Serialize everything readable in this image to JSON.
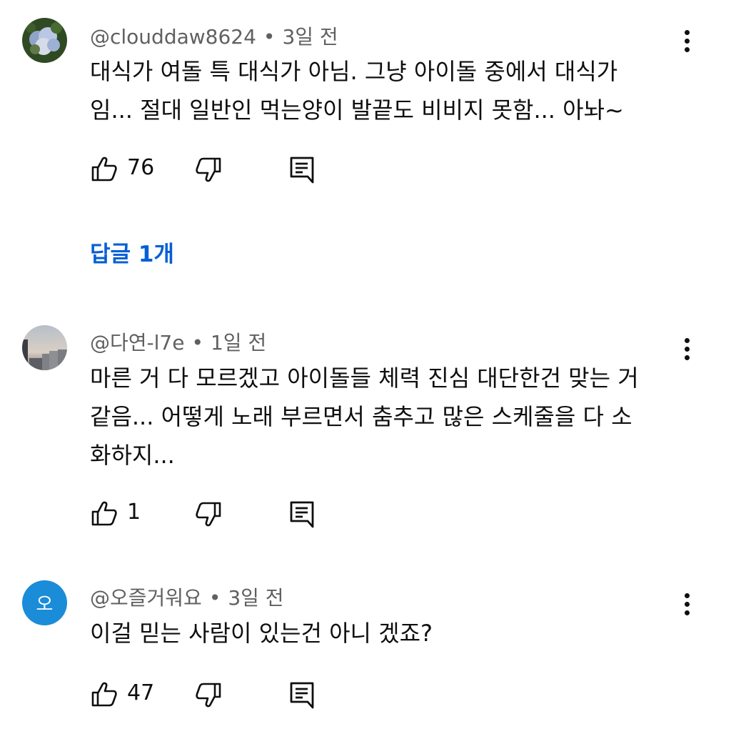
{
  "comments": [
    {
      "author": "@clouddaw8624",
      "time": "3일 전",
      "lines": [
        "대식가 여돌 특 대식가 아님. 그냥 아이돌 중에서 대식가",
        "임... 절대 일반인 먹는양이 발끝도 비비지 못함... 아놔~"
      ],
      "likes": "76",
      "avatar": "hydrangea-photo",
      "replies": "답글 1개"
    },
    {
      "author": "@다연-l7e",
      "time": "1일 전",
      "lines": [
        "마른 거 다 모르겠고 아이돌들 체력 진심 대단한건 맞는 거",
        "같음... 어떻게 노래 부르면서 춤추고 많은 스케줄을 다 소",
        "화하지..."
      ],
      "likes": "1",
      "avatar": "sunset-city-photo"
    },
    {
      "author": "@오즐거워요",
      "time": "3일 전",
      "lines": [
        "이걸 믿는 사람이 있는건 아니 겠죠?"
      ],
      "likes": "47",
      "avatar_initial": "오",
      "avatar_color": "#1a8cd8"
    }
  ],
  "separator": "•",
  "colors": {
    "link": "#065fd4",
    "meta": "#606060",
    "text": "#0f0f0f"
  }
}
